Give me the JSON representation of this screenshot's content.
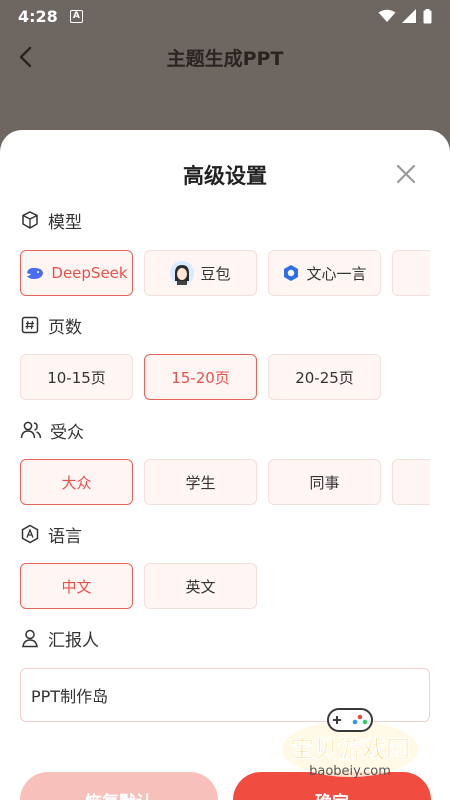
{
  "status_bar": {
    "time": "4:28",
    "notif": "A"
  },
  "header": {
    "title": "主题生成PPT"
  },
  "sheet": {
    "title": "高级设置"
  },
  "sections": {
    "model": {
      "label": "模型",
      "options": [
        "DeepSeek",
        "豆包",
        "文心一言",
        ""
      ],
      "selected": "DeepSeek"
    },
    "pages": {
      "label": "页数",
      "options": [
        "10-15页",
        "15-20页",
        "20-25页"
      ],
      "selected": "15-20页"
    },
    "audience": {
      "label": "受众",
      "options": [
        "大众",
        "学生",
        "同事",
        ""
      ],
      "selected": "大众"
    },
    "language": {
      "label": "语言",
      "options": [
        "中文",
        "英文"
      ],
      "selected": "中文"
    },
    "reporter": {
      "label": "汇报人",
      "value": "PPT制作岛"
    }
  },
  "buttons": {
    "reset": "恢复默认",
    "confirm": "确定"
  },
  "watermark": {
    "brand": "宝贝游戏网",
    "url": "baobeiy.com"
  },
  "colors": {
    "accent": "#e8524a",
    "chip_bg": "#fff5f3",
    "overlay": "#6e6661",
    "confirm": "#f04c40",
    "reset": "#f7c0bb"
  }
}
